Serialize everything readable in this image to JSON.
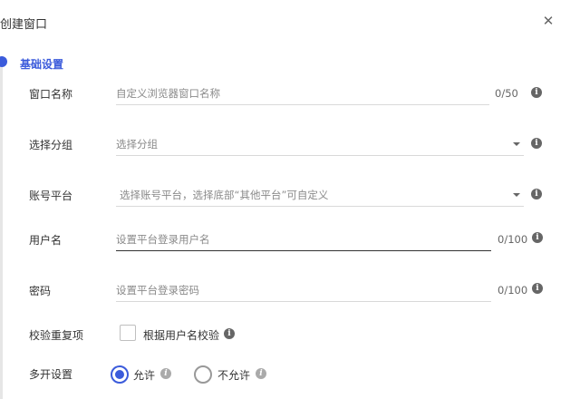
{
  "dialog": {
    "title": "创建窗口",
    "close_glyph": "✕"
  },
  "section": {
    "title": "基础设置"
  },
  "fields": {
    "window_name": {
      "label": "窗口名称",
      "placeholder": "自定义浏览器窗口名称",
      "counter": "0/50"
    },
    "group": {
      "label": "选择分组",
      "placeholder": "选择分组"
    },
    "platform": {
      "label": "账号平台",
      "placeholder": "选择账号平台，选择底部“其他平台”可自定义"
    },
    "username": {
      "label": "用户名",
      "placeholder": "设置平台登录用户名",
      "counter": "0/100"
    },
    "password": {
      "label": "密码",
      "placeholder": "设置平台登录密码",
      "counter": "0/100"
    }
  },
  "dedupe": {
    "label": "校验重复项",
    "checkbox_label": "根据用户名校验",
    "checked": false
  },
  "multi_open": {
    "label": "多开设置",
    "options": [
      "允许",
      "不允许"
    ],
    "selected": "允许"
  },
  "colors": {
    "accent": "#3b5bdb",
    "text": "#333333",
    "muted": "#8a8a8a",
    "border": "#d9d9d9"
  },
  "icons": {
    "info": "info-icon",
    "close": "close-icon",
    "dropdown": "caret-down-icon"
  }
}
